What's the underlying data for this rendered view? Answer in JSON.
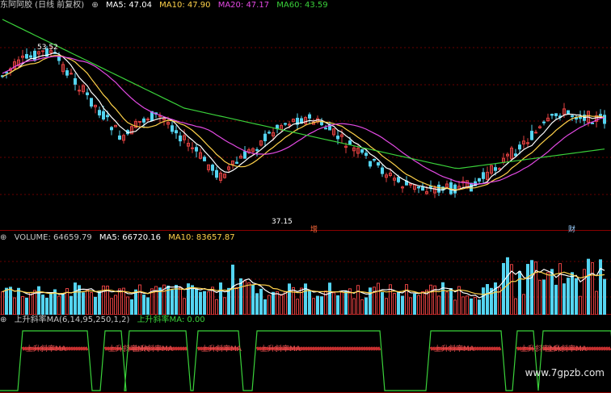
{
  "main": {
    "title": "东阿阿胶 (日线 前复权)",
    "ma": [
      {
        "label": "MA5: 47.04",
        "color": "#ffffff"
      },
      {
        "label": "MA10: 47.90",
        "color": "#ffd24a"
      },
      {
        "label": "MA20: 47.17",
        "color": "#e44ae4"
      },
      {
        "label": "MA60: 43.59",
        "color": "#3ad23a"
      }
    ],
    "high_label": "53.52",
    "low_label": "37.15",
    "event_markers": [
      "增",
      "财"
    ]
  },
  "volume": {
    "header": "VOLUME: 64659.79",
    "ma5": "MA5: 66720.16",
    "ma10": "MA10: 83657.87"
  },
  "indicator": {
    "header": "上升斜率MA(6,14,95,250,1,2)",
    "value": "上升斜率MA: 0.00",
    "band_label": "上升斜率MA"
  },
  "watermark": "www.7gpzb.com",
  "colors": {
    "up": "#e04040",
    "down": "#54d4f0",
    "grid": "#5a0000",
    "text": "#c8c8c8"
  }
}
